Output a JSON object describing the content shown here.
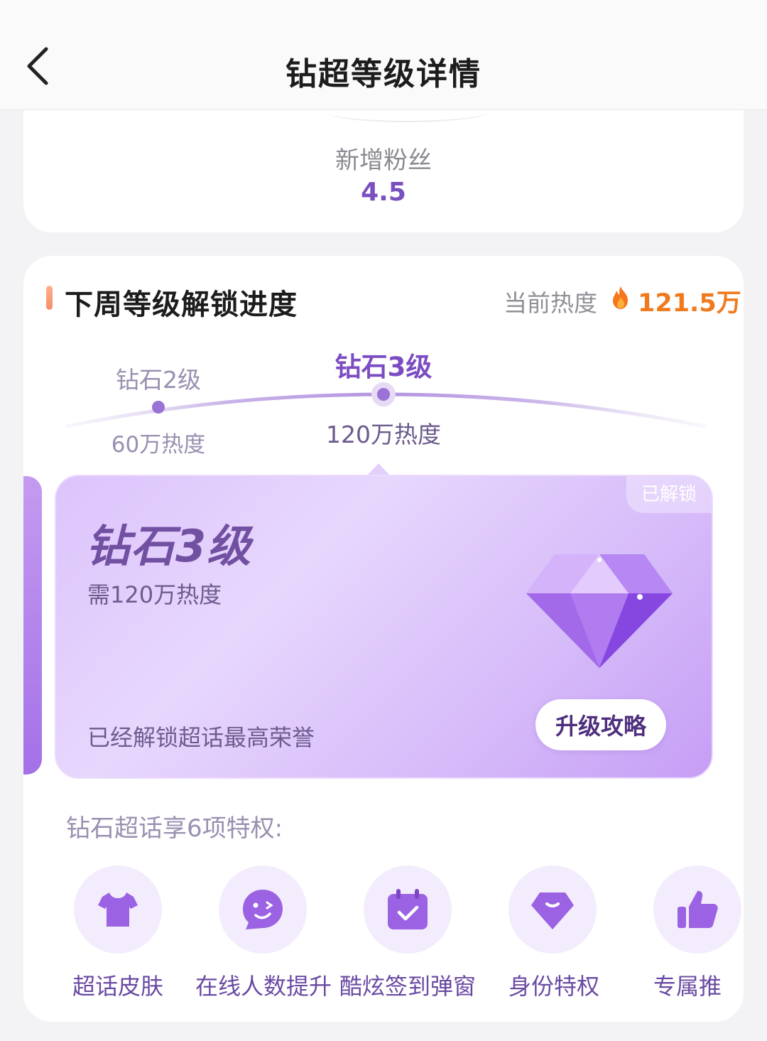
{
  "header": {
    "title": "钻超等级详情"
  },
  "stats": {
    "label": "新增粉丝",
    "value": "4.5"
  },
  "progress": {
    "section_title": "下周等级解锁进度",
    "current_heat_label": "当前热度",
    "current_heat_value": "121.5万"
  },
  "levels": [
    {
      "name": "钻石2级",
      "requirement": "60万热度"
    },
    {
      "name": "钻石3级",
      "requirement": "120万热度"
    }
  ],
  "level_card": {
    "badge": "已解锁",
    "title": "钻石3级",
    "need": "需120万热度",
    "honor": "已经解锁超话最高荣誉",
    "button": "升级攻略"
  },
  "privileges": {
    "title": "钻石超话享6项特权:",
    "items": [
      {
        "label": "超话皮肤",
        "icon": "tshirt-icon"
      },
      {
        "label": "在线人数提升",
        "icon": "wink-chat-icon"
      },
      {
        "label": "酷炫签到弹窗",
        "icon": "calendar-check-icon"
      },
      {
        "label": "身份特权",
        "icon": "gem-smile-icon"
      },
      {
        "label": "专属推",
        "icon": "thumbs-up-icon"
      }
    ]
  },
  "colors": {
    "accent_purple": "#7b4cc2",
    "heat_orange": "#f07a1e",
    "card_gradient_start": "#dcc4fb",
    "card_gradient_end": "#c69ef5"
  }
}
